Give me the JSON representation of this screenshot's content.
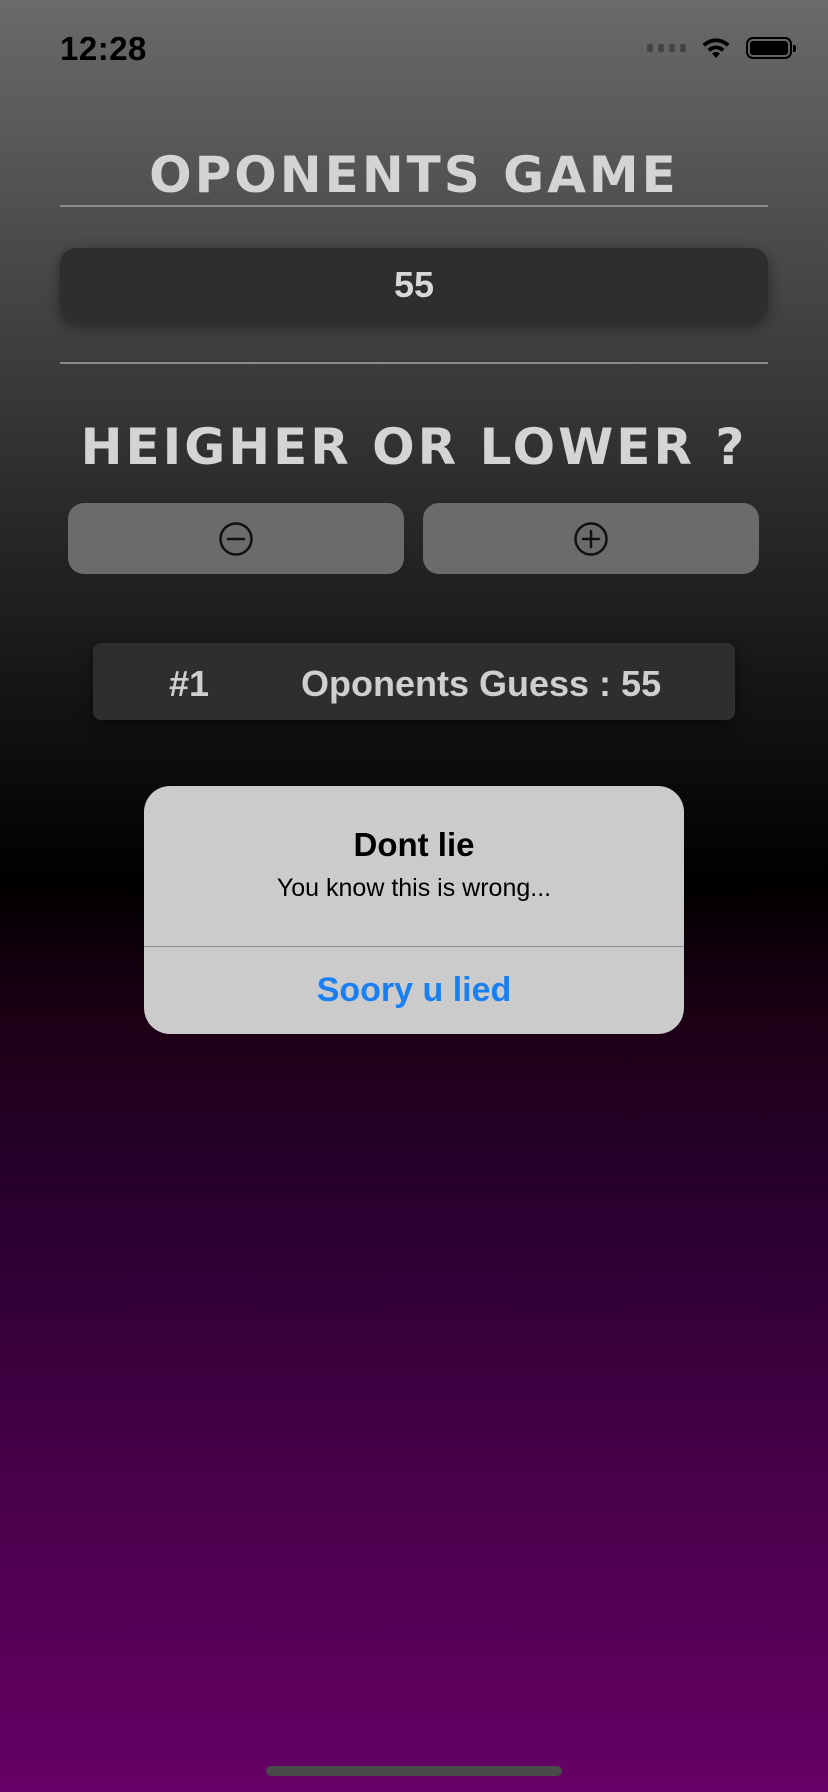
{
  "status_bar": {
    "time": "12:28",
    "icons": [
      "signal-icon",
      "wifi-icon",
      "battery-icon"
    ]
  },
  "header": {
    "title": "OPONENTS GAME"
  },
  "current_number": "55",
  "prompt": {
    "text": "HEIGHER OR LOWER ?"
  },
  "buttons": {
    "lower_icon": "minus-circle-icon",
    "higher_icon": "plus-circle-icon"
  },
  "guesses": [
    {
      "index": "#1",
      "text": "Oponents Guess : 55"
    }
  ],
  "alert": {
    "title": "Dont lie",
    "message": "You know this is wrong...",
    "action_label": "Soory u lied",
    "action_color": "#1a7ff0"
  }
}
